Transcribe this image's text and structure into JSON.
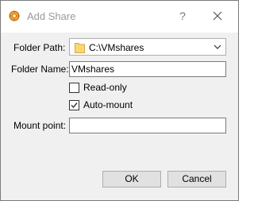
{
  "window": {
    "title": "Add Share",
    "help_label": "?",
    "app_icon": "virtualbox-gear-icon",
    "close_icon": "close-icon"
  },
  "form": {
    "folder_path_label": "Folder Path:",
    "folder_path_value": "C:\\VMshares",
    "folder_icon": "folder-icon",
    "folder_name_label": "Folder Name:",
    "folder_name_value": "VMshares",
    "readonly_label": "Read-only",
    "readonly_checked": false,
    "automount_label": "Auto-mount",
    "automount_checked": true,
    "mount_point_label": "Mount point:",
    "mount_point_value": ""
  },
  "buttons": {
    "ok_label": "OK",
    "cancel_label": "Cancel"
  },
  "colors": {
    "dialog_bg": "#f0f0f0",
    "titlebar_bg": "#ffffff",
    "title_text": "#999999",
    "folder_yellow": "#f8d775"
  }
}
